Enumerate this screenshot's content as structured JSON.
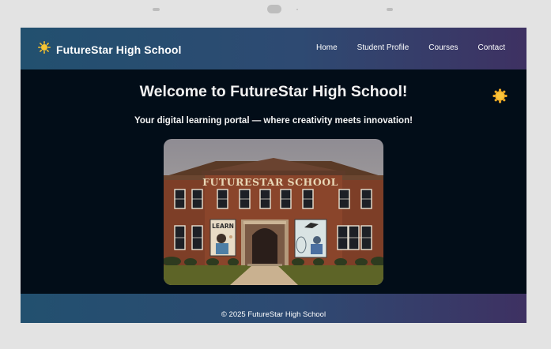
{
  "header": {
    "brand_title": "FutureStar High School",
    "brand_icon": "sun-icon",
    "nav": [
      "Home",
      "Student Profile",
      "Courses",
      "Contact"
    ]
  },
  "main": {
    "welcome": "Welcome to FutureStar High School!",
    "tagline": "Your digital learning portal — where creativity meets innovation!",
    "decor_icon": "sun-icon",
    "hero": {
      "building_sign": "FUTURESTAR SCHOOL",
      "poster_left": "LEARN"
    }
  },
  "footer": {
    "copyright": "© 2025 FutureStar High School"
  },
  "colors": {
    "header_start": "#22506f",
    "header_end": "#3e3162",
    "page_bg": "#020d18",
    "sun": "#f5b82e"
  }
}
